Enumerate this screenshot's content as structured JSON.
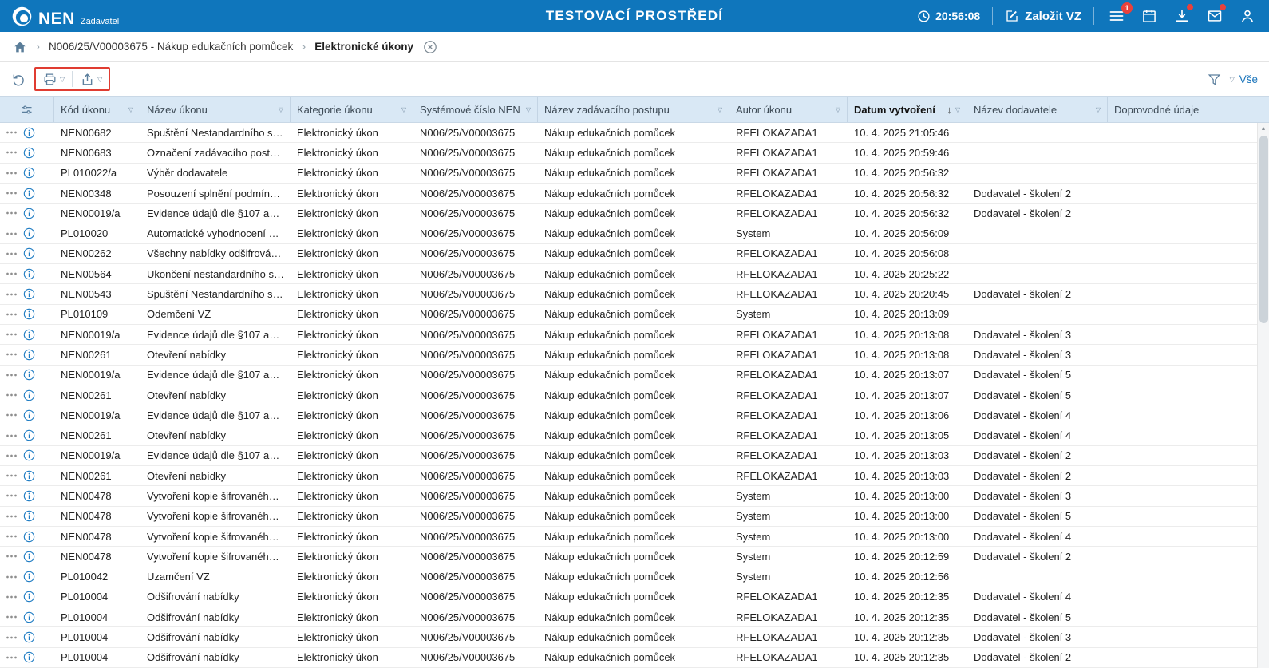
{
  "header": {
    "brand": "NEN",
    "role": "Zadavatel",
    "env_title": "TESTOVACÍ PROSTŘEDÍ",
    "clock": "20:56:08",
    "create_vz_label": "Založit VZ",
    "menu_badge": "1",
    "accent_blue": "#0f76bc",
    "badge_red": "#e8413c"
  },
  "breadcrumb": {
    "procurement": "N006/25/V00003675 - Nákup edukačních pomůcek",
    "current": "Elektronické úkony"
  },
  "toolbar": {
    "filter_scope_label": "Vše",
    "annotation_color": "#e03c31"
  },
  "table": {
    "columns": [
      {
        "key": "kod",
        "label": "Kód úkonu",
        "filter": true
      },
      {
        "key": "nazev",
        "label": "Název úkonu",
        "filter": true
      },
      {
        "key": "kategorie",
        "label": "Kategorie úkonu",
        "filter": true
      },
      {
        "key": "cislo",
        "label": "Systémové číslo NEN",
        "filter": true
      },
      {
        "key": "postup",
        "label": "Název zadávacího postupu",
        "filter": true
      },
      {
        "key": "autor",
        "label": "Autor úkonu",
        "filter": true
      },
      {
        "key": "datum",
        "label": "Datum vytvoření",
        "filter": true,
        "bold": true,
        "sorted": "desc"
      },
      {
        "key": "dodavatel",
        "label": "Název dodavatele",
        "filter": true
      },
      {
        "key": "doprovodne",
        "label": "Doprovodné údaje",
        "filter": false
      }
    ],
    "rows": [
      {
        "kod": "NEN00682",
        "nazev": "Spuštění Nestandardního st…",
        "kategorie": "Elektronický úkon",
        "cislo": "N006/25/V00003675",
        "postup": "Nákup edukačních pomůcek",
        "autor": "RFELOKAZADA1",
        "datum": "10. 4. 2025 21:05:46",
        "dodavatel": "",
        "doprovodne": ""
      },
      {
        "kod": "NEN00683",
        "nazev": "Označení zadávacího postu…",
        "kategorie": "Elektronický úkon",
        "cislo": "N006/25/V00003675",
        "postup": "Nákup edukačních pomůcek",
        "autor": "RFELOKAZADA1",
        "datum": "10. 4. 2025 20:59:46",
        "dodavatel": "",
        "doprovodne": ""
      },
      {
        "kod": "PL010022/a",
        "nazev": "Výběr dodavatele",
        "kategorie": "Elektronický úkon",
        "cislo": "N006/25/V00003675",
        "postup": "Nákup edukačních pomůcek",
        "autor": "RFELOKAZADA1",
        "datum": "10. 4. 2025 20:56:32",
        "dodavatel": "",
        "doprovodne": ""
      },
      {
        "kod": "NEN00348",
        "nazev": "Posouzení splnění podmíne…",
        "kategorie": "Elektronický úkon",
        "cislo": "N006/25/V00003675",
        "postup": "Nákup edukačních pomůcek",
        "autor": "RFELOKAZADA1",
        "datum": "10. 4. 2025 20:56:32",
        "dodavatel": "Dodavatel - školení 2",
        "doprovodne": ""
      },
      {
        "kod": "NEN00019/a",
        "nazev": "Evidence údajů dle §107 až …",
        "kategorie": "Elektronický úkon",
        "cislo": "N006/25/V00003675",
        "postup": "Nákup edukačních pomůcek",
        "autor": "RFELOKAZADA1",
        "datum": "10. 4. 2025 20:56:32",
        "dodavatel": "Dodavatel - školení 2",
        "doprovodne": ""
      },
      {
        "kod": "PL010020",
        "nazev": "Automatické vyhodnocení n…",
        "kategorie": "Elektronický úkon",
        "cislo": "N006/25/V00003675",
        "postup": "Nákup edukačních pomůcek",
        "autor": "System",
        "datum": "10. 4. 2025 20:56:09",
        "dodavatel": "",
        "doprovodne": ""
      },
      {
        "kod": "NEN00262",
        "nazev": "Všechny nabídky odšifrován…",
        "kategorie": "Elektronický úkon",
        "cislo": "N006/25/V00003675",
        "postup": "Nákup edukačních pomůcek",
        "autor": "RFELOKAZADA1",
        "datum": "10. 4. 2025 20:56:08",
        "dodavatel": "",
        "doprovodne": ""
      },
      {
        "kod": "NEN00564",
        "nazev": "Ukončení nestandardního st…",
        "kategorie": "Elektronický úkon",
        "cislo": "N006/25/V00003675",
        "postup": "Nákup edukačních pomůcek",
        "autor": "RFELOKAZADA1",
        "datum": "10. 4. 2025 20:25:22",
        "dodavatel": "",
        "doprovodne": ""
      },
      {
        "kod": "NEN00543",
        "nazev": "Spuštění Nestandardního st…",
        "kategorie": "Elektronický úkon",
        "cislo": "N006/25/V00003675",
        "postup": "Nákup edukačních pomůcek",
        "autor": "RFELOKAZADA1",
        "datum": "10. 4. 2025 20:20:45",
        "dodavatel": "Dodavatel - školení 2",
        "doprovodne": ""
      },
      {
        "kod": "PL010109",
        "nazev": "Odemčení VZ",
        "kategorie": "Elektronický úkon",
        "cislo": "N006/25/V00003675",
        "postup": "Nákup edukačních pomůcek",
        "autor": "System",
        "datum": "10. 4. 2025 20:13:09",
        "dodavatel": "",
        "doprovodne": ""
      },
      {
        "kod": "NEN00019/a",
        "nazev": "Evidence údajů dle §107 až …",
        "kategorie": "Elektronický úkon",
        "cislo": "N006/25/V00003675",
        "postup": "Nákup edukačních pomůcek",
        "autor": "RFELOKAZADA1",
        "datum": "10. 4. 2025 20:13:08",
        "dodavatel": "Dodavatel - školení 3",
        "doprovodne": ""
      },
      {
        "kod": "NEN00261",
        "nazev": "Otevření nabídky",
        "kategorie": "Elektronický úkon",
        "cislo": "N006/25/V00003675",
        "postup": "Nákup edukačních pomůcek",
        "autor": "RFELOKAZADA1",
        "datum": "10. 4. 2025 20:13:08",
        "dodavatel": "Dodavatel - školení 3",
        "doprovodne": ""
      },
      {
        "kod": "NEN00019/a",
        "nazev": "Evidence údajů dle §107 až …",
        "kategorie": "Elektronický úkon",
        "cislo": "N006/25/V00003675",
        "postup": "Nákup edukačních pomůcek",
        "autor": "RFELOKAZADA1",
        "datum": "10. 4. 2025 20:13:07",
        "dodavatel": "Dodavatel - školení 5",
        "doprovodne": ""
      },
      {
        "kod": "NEN00261",
        "nazev": "Otevření nabídky",
        "kategorie": "Elektronický úkon",
        "cislo": "N006/25/V00003675",
        "postup": "Nákup edukačních pomůcek",
        "autor": "RFELOKAZADA1",
        "datum": "10. 4. 2025 20:13:07",
        "dodavatel": "Dodavatel - školení 5",
        "doprovodne": ""
      },
      {
        "kod": "NEN00019/a",
        "nazev": "Evidence údajů dle §107 až …",
        "kategorie": "Elektronický úkon",
        "cislo": "N006/25/V00003675",
        "postup": "Nákup edukačních pomůcek",
        "autor": "RFELOKAZADA1",
        "datum": "10. 4. 2025 20:13:06",
        "dodavatel": "Dodavatel - školení 4",
        "doprovodne": ""
      },
      {
        "kod": "NEN00261",
        "nazev": "Otevření nabídky",
        "kategorie": "Elektronický úkon",
        "cislo": "N006/25/V00003675",
        "postup": "Nákup edukačních pomůcek",
        "autor": "RFELOKAZADA1",
        "datum": "10. 4. 2025 20:13:05",
        "dodavatel": "Dodavatel - školení 4",
        "doprovodne": ""
      },
      {
        "kod": "NEN00019/a",
        "nazev": "Evidence údajů dle §107 až …",
        "kategorie": "Elektronický úkon",
        "cislo": "N006/25/V00003675",
        "postup": "Nákup edukačních pomůcek",
        "autor": "RFELOKAZADA1",
        "datum": "10. 4. 2025 20:13:03",
        "dodavatel": "Dodavatel - školení 2",
        "doprovodne": ""
      },
      {
        "kod": "NEN00261",
        "nazev": "Otevření nabídky",
        "kategorie": "Elektronický úkon",
        "cislo": "N006/25/V00003675",
        "postup": "Nákup edukačních pomůcek",
        "autor": "RFELOKAZADA1",
        "datum": "10. 4. 2025 20:13:03",
        "dodavatel": "Dodavatel - školení 2",
        "doprovodne": ""
      },
      {
        "kod": "NEN00478",
        "nazev": "Vytvoření kopie šifrovaného …",
        "kategorie": "Elektronický úkon",
        "cislo": "N006/25/V00003675",
        "postup": "Nákup edukačních pomůcek",
        "autor": "System",
        "datum": "10. 4. 2025 20:13:00",
        "dodavatel": "Dodavatel - školení 3",
        "doprovodne": ""
      },
      {
        "kod": "NEN00478",
        "nazev": "Vytvoření kopie šifrovaného …",
        "kategorie": "Elektronický úkon",
        "cislo": "N006/25/V00003675",
        "postup": "Nákup edukačních pomůcek",
        "autor": "System",
        "datum": "10. 4. 2025 20:13:00",
        "dodavatel": "Dodavatel - školení 5",
        "doprovodne": ""
      },
      {
        "kod": "NEN00478",
        "nazev": "Vytvoření kopie šifrovaného …",
        "kategorie": "Elektronický úkon",
        "cislo": "N006/25/V00003675",
        "postup": "Nákup edukačních pomůcek",
        "autor": "System",
        "datum": "10. 4. 2025 20:13:00",
        "dodavatel": "Dodavatel - školení 4",
        "doprovodne": ""
      },
      {
        "kod": "NEN00478",
        "nazev": "Vytvoření kopie šifrovaného …",
        "kategorie": "Elektronický úkon",
        "cislo": "N006/25/V00003675",
        "postup": "Nákup edukačních pomůcek",
        "autor": "System",
        "datum": "10. 4. 2025 20:12:59",
        "dodavatel": "Dodavatel - školení 2",
        "doprovodne": ""
      },
      {
        "kod": "PL010042",
        "nazev": "Uzamčení VZ",
        "kategorie": "Elektronický úkon",
        "cislo": "N006/25/V00003675",
        "postup": "Nákup edukačních pomůcek",
        "autor": "System",
        "datum": "10. 4. 2025 20:12:56",
        "dodavatel": "",
        "doprovodne": ""
      },
      {
        "kod": "PL010004",
        "nazev": "Odšifrování nabídky",
        "kategorie": "Elektronický úkon",
        "cislo": "N006/25/V00003675",
        "postup": "Nákup edukačních pomůcek",
        "autor": "RFELOKAZADA1",
        "datum": "10. 4. 2025 20:12:35",
        "dodavatel": "Dodavatel - školení 4",
        "doprovodne": ""
      },
      {
        "kod": "PL010004",
        "nazev": "Odšifrování nabídky",
        "kategorie": "Elektronický úkon",
        "cislo": "N006/25/V00003675",
        "postup": "Nákup edukačních pomůcek",
        "autor": "RFELOKAZADA1",
        "datum": "10. 4. 2025 20:12:35",
        "dodavatel": "Dodavatel - školení 5",
        "doprovodne": ""
      },
      {
        "kod": "PL010004",
        "nazev": "Odšifrování nabídky",
        "kategorie": "Elektronický úkon",
        "cislo": "N006/25/V00003675",
        "postup": "Nákup edukačních pomůcek",
        "autor": "RFELOKAZADA1",
        "datum": "10. 4. 2025 20:12:35",
        "dodavatel": "Dodavatel - školení 3",
        "doprovodne": ""
      },
      {
        "kod": "PL010004",
        "nazev": "Odšifrování nabídky",
        "kategorie": "Elektronický úkon",
        "cislo": "N006/25/V00003675",
        "postup": "Nákup edukačních pomůcek",
        "autor": "RFELOKAZADA1",
        "datum": "10. 4. 2025 20:12:35",
        "dodavatel": "Dodavatel - školení 2",
        "doprovodne": ""
      }
    ]
  }
}
